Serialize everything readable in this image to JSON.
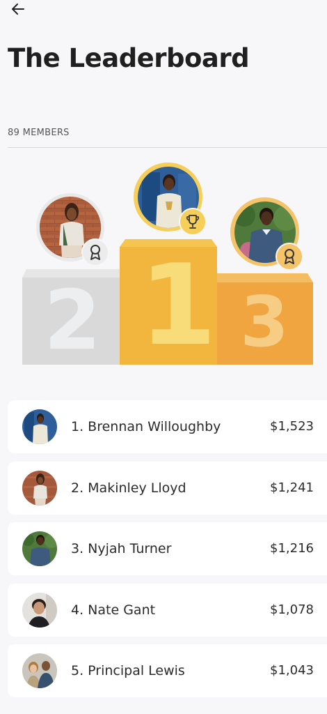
{
  "header": {
    "back_icon": "arrow-left-icon",
    "title": "The Leaderboard",
    "member_count": "89 MEMBERS"
  },
  "podium": {
    "first": {
      "rank_numeral": "1",
      "badge_icon": "trophy-icon"
    },
    "second": {
      "rank_numeral": "2",
      "badge_icon": "ribbon-award-icon"
    },
    "third": {
      "rank_numeral": "3",
      "badge_icon": "ribbon-award-icon"
    },
    "colors": {
      "gold": "#f2b53d",
      "gold_top": "#f6c54f",
      "gold_numeral": "#f8dc7a",
      "silver": "#d9d9d9",
      "silver_numeral": "#e8eaeb",
      "bronze": "#f0a540",
      "bronze_numeral": "#f7cd85"
    }
  },
  "leaders": [
    {
      "name": "1. Brennan Willoughby",
      "amount": "$1,523"
    },
    {
      "name": "2. Makinley Lloyd",
      "amount": "$1,241"
    },
    {
      "name": "3. Nyjah Turner",
      "amount": "$1,216"
    },
    {
      "name": "4. Nate Gant",
      "amount": "$1,078"
    },
    {
      "name": "5. Principal Lewis",
      "amount": "$1,043"
    }
  ]
}
